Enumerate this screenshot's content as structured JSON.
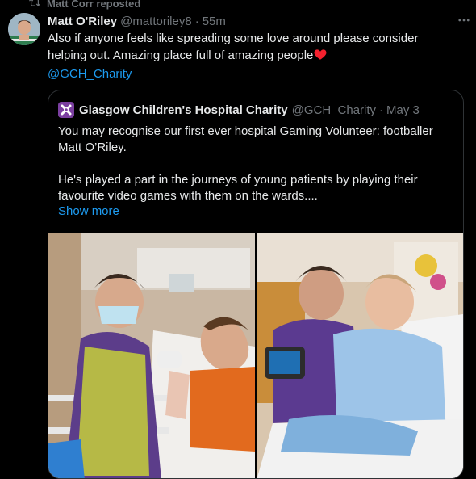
{
  "repost": {
    "label": "Matt Corr reposted",
    "icon": "repost-icon"
  },
  "tweet": {
    "author_name": "Matt O'Riley",
    "author_handle": "@mattoriley8",
    "separator": "·",
    "time": "55m",
    "text": "Also if anyone feels like spreading some love around please consider helping out. Amazing place full of amazing people",
    "emoji": "red-heart-icon",
    "mention": "@GCH_Charity",
    "more_icon": "more-icon"
  },
  "quote": {
    "author_name": "Glasgow Children's Hospital Charity",
    "author_handle": "@GCH_Charity",
    "separator": "·",
    "date": "May 3",
    "paragraph1": "You may recognise our first ever hospital Gaming Volunteer: footballer Matt O’Riley.",
    "paragraph2": "He's played a part in the journeys of young patients by playing their favourite video games with them on the wards....",
    "show_more": "Show more"
  },
  "colors": {
    "background": "#000000",
    "text": "#e7e9ea",
    "muted": "#71767b",
    "link": "#1d9bf0",
    "border": "#2f3336"
  }
}
